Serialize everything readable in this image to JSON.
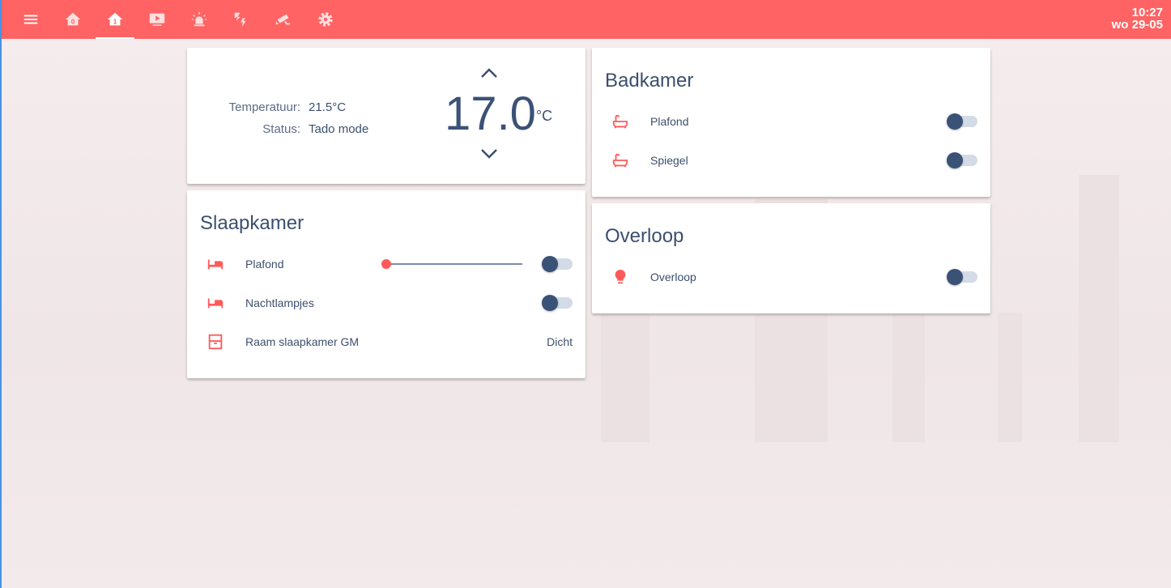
{
  "topbar": {
    "icons": [
      "menu-icon",
      "home-floor-0-icon",
      "home-floor-1-icon",
      "media-icon",
      "alarm-light-icon",
      "weather-lightning-icon",
      "cctv-icon",
      "settings-icon"
    ],
    "active": 2,
    "time": "10:27",
    "date": "wo 29-05"
  },
  "colors": {
    "accent": "#ff6363",
    "text": "#3c4f6e",
    "knob": "#3b5277"
  },
  "thermostat": {
    "temp_label": "Temperatuur:",
    "temp_value": "21.5°C",
    "status_label": "Status:",
    "status_value": "Tado mode",
    "setpoint": "17.0",
    "unit": "°C"
  },
  "slaapkamer": {
    "title": "Slaapkamer",
    "items": [
      {
        "label": "Plafond",
        "icon": "bed-icon",
        "brightness": 0,
        "state": "off"
      },
      {
        "label": "Nachtlampjes",
        "icon": "bed-icon",
        "state": "off"
      },
      {
        "label": "Raam slaapkamer GM",
        "icon": "window-icon",
        "state": "Dicht"
      }
    ]
  },
  "badkamer": {
    "title": "Badkamer",
    "items": [
      {
        "label": "Plafond",
        "icon": "bathtub-icon",
        "state": "off"
      },
      {
        "label": "Spiegel",
        "icon": "bathtub-icon",
        "state": "off"
      }
    ]
  },
  "overloop": {
    "title": "Overloop",
    "items": [
      {
        "label": "Overloop",
        "icon": "lightbulb-icon",
        "state": "off"
      }
    ]
  }
}
